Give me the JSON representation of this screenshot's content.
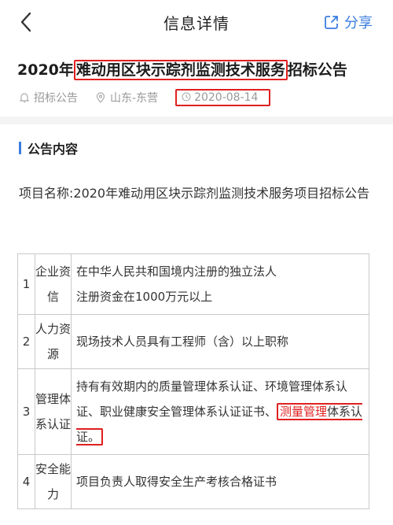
{
  "nav": {
    "title": "信息详情",
    "share_label": "分享"
  },
  "article": {
    "title_prefix": "2020年",
    "title_highlight": "难动用区块示踪剂监测技术服务",
    "title_suffix": "招标公告",
    "meta": {
      "type": "招标公告",
      "region": "山东-东营",
      "date": "2020-08-14"
    }
  },
  "section": {
    "title": "公告内容",
    "paragraph": "项目名称:2020年难动用区块示踪剂监测技术服务项目招标公告"
  },
  "requirements": [
    {
      "num": "1",
      "category": "企业资信",
      "lines": [
        "在中华人民共和国境内注册的独立法人",
        "注册资金在1000万元以上"
      ]
    },
    {
      "num": "2",
      "category": "人力资源",
      "lines": [
        "现场技术人员具有工程师（含）以上职称"
      ]
    },
    {
      "num": "3",
      "category": "管理体系认证",
      "text_main": "持有有效期内的质量管理体系认证、环境管理体系认证、职业健康安全管理体系认证证书、",
      "text_red": "测量管理",
      "text_tail": "体系认证。"
    },
    {
      "num": "4",
      "category": "安全能力",
      "lines": [
        "项目负责人取得安全生产考核合格证书"
      ]
    }
  ],
  "colors": {
    "accent": "#3a7de0",
    "highlight": "#e02020"
  }
}
